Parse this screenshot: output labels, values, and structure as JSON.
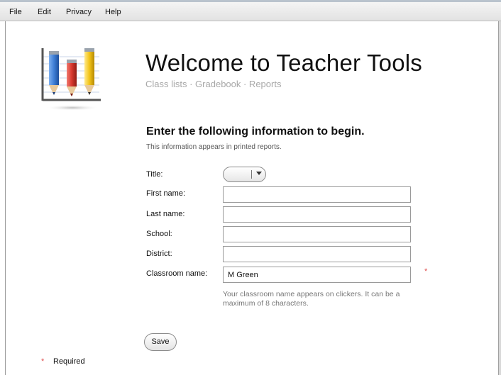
{
  "menu": [
    "File",
    "Edit",
    "Privacy",
    "Help"
  ],
  "header": {
    "title": "Welcome to Teacher Tools",
    "subtitle": "Class lists · Gradebook · Reports"
  },
  "form": {
    "heading": "Enter the following information to begin.",
    "subheading": "This information appears in printed reports.",
    "fields": {
      "title": {
        "label": "Title:",
        "value": ""
      },
      "first_name": {
        "label": "First name:",
        "value": ""
      },
      "last_name": {
        "label": "Last name:",
        "value": ""
      },
      "school": {
        "label": "School:",
        "value": ""
      },
      "district": {
        "label": "District:",
        "value": ""
      },
      "classroom_name": {
        "label": "Classroom name:",
        "value": "M Green"
      }
    },
    "required_marker": "*",
    "classroom_help": "Your classroom name appears on clickers. It can be a maximum of 8 characters.",
    "save_label": "Save"
  },
  "footer": {
    "required_marker": "*",
    "required_label": "Required"
  },
  "colors": {
    "required": "#e05050",
    "pencil_blue": "#3f7fd6",
    "pencil_red": "#d8382e",
    "pencil_yellow": "#f2c318"
  },
  "icons": {
    "logo": "pencil-bar-chart-icon",
    "dropdown": "dropdown-caret-icon"
  }
}
